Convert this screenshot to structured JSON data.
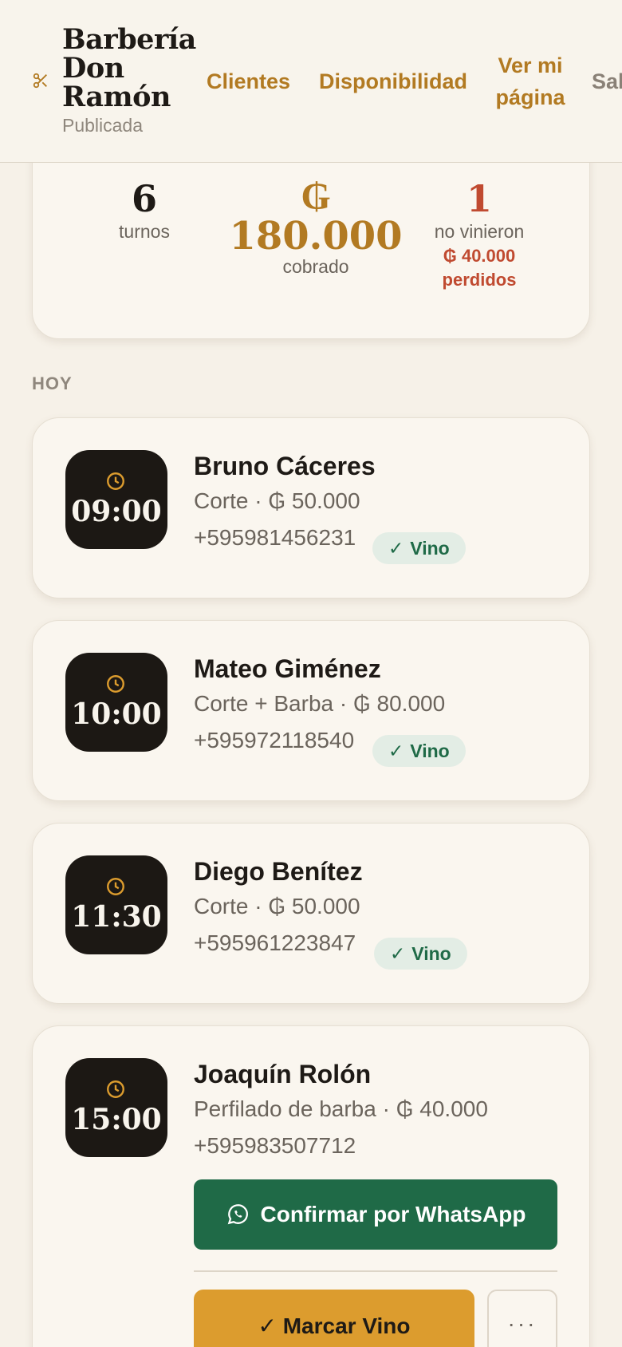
{
  "header": {
    "brand_name": "Barbería Don Ramón",
    "status": "Publicada",
    "nav": {
      "clientes": "Clientes",
      "disponibilidad": "Disponibilidad",
      "ver_pagina": "Ver mi página",
      "salir": "Sal"
    },
    "accent_color": "#b27a22"
  },
  "summary": {
    "turnos_count": "6",
    "turnos_label": "turnos",
    "cobrado_currency": "₲",
    "cobrado_amount": "180.000",
    "cobrado_label": "cobrado",
    "no_vinieron_count": "1",
    "no_vinieron_label": "no vinieron",
    "perdidos_amount": "₲ 40.000",
    "perdidos_label": "perdidos"
  },
  "section_title": "HOY",
  "appointments": [
    {
      "time": "09:00",
      "client": "Bruno Cáceres",
      "service": "Corte · ₲ 50.000",
      "phone": "+595981456231",
      "status": "Vino"
    },
    {
      "time": "10:00",
      "client": "Mateo Giménez",
      "service": "Corte + Barba · ₲ 80.000",
      "phone": "+595972118540",
      "status": "Vino"
    },
    {
      "time": "11:30",
      "client": "Diego Benítez",
      "service": "Corte · ₲ 50.000",
      "phone": "+595961223847",
      "status": "Vino"
    },
    {
      "time": "15:00",
      "client": "Joaquín Rolón",
      "service": "Perfilado de barba · ₲ 40.000",
      "phone": "+595983507712",
      "whatsapp_label": "Confirmar por WhatsApp",
      "marcar_label": "✓ Marcar Vino",
      "more_label": "···"
    }
  ],
  "status_check": "✓",
  "icons": {
    "brand": "scissors-icon",
    "time": "clock-icon",
    "whatsapp": "whatsapp-icon"
  },
  "colors": {
    "dark": "#1c1814",
    "green": "#1f6a47",
    "gold": "#dc9c2e",
    "red": "#c04a30"
  }
}
